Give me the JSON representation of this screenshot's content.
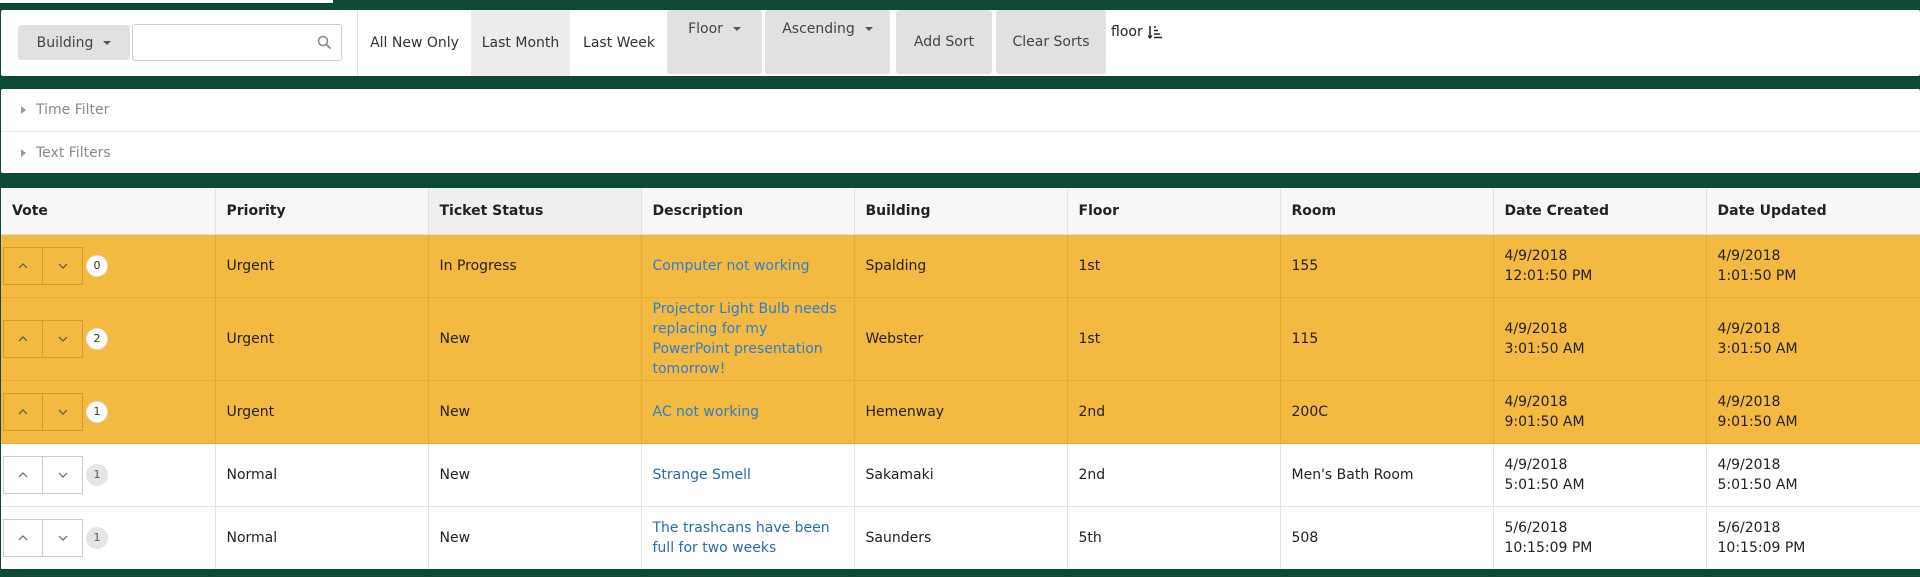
{
  "toolbar": {
    "building_label": "Building",
    "search_value": "",
    "search_placeholder": "",
    "all_new_only": "All New Only",
    "last_month": "Last Month",
    "last_week": "Last Week",
    "floor_label": "Floor",
    "ascending_label": "Ascending",
    "add_sort": "Add Sort",
    "clear_sorts": "Clear Sorts",
    "sort_indicator": "floor"
  },
  "filters": {
    "time_filter": "Time Filter",
    "text_filters": "Text Filters"
  },
  "table": {
    "headers": [
      "Vote",
      "Priority",
      "Ticket Status",
      "Description",
      "Building",
      "Floor",
      "Room",
      "Date Created",
      "Date Updated"
    ],
    "rows": [
      {
        "votes": "0",
        "priority": "Urgent",
        "status": "In Progress",
        "description": "Computer not working",
        "building": "Spalding",
        "floor": "1st",
        "room": "155",
        "created_date": "4/9/2018",
        "created_time": "12:01:50 PM",
        "updated_date": "4/9/2018",
        "updated_time": "1:01:50 PM"
      },
      {
        "votes": "2",
        "priority": "Urgent",
        "status": "New",
        "description": "Projector Light Bulb needs replacing for my PowerPoint presentation tomorrow!",
        "building": "Webster",
        "floor": "1st",
        "room": "115",
        "created_date": "4/9/2018",
        "created_time": "3:01:50 AM",
        "updated_date": "4/9/2018",
        "updated_time": "3:01:50 AM"
      },
      {
        "votes": "1",
        "priority": "Urgent",
        "status": "New",
        "description": "AC not working",
        "building": "Hemenway",
        "floor": "2nd",
        "room": "200C",
        "created_date": "4/9/2018",
        "created_time": "9:01:50 AM",
        "updated_date": "4/9/2018",
        "updated_time": "9:01:50 AM"
      },
      {
        "votes": "1",
        "priority": "Normal",
        "status": "New",
        "description": "Strange Smell",
        "building": "Sakamaki",
        "floor": "2nd",
        "room": "Men's Bath Room",
        "created_date": "4/9/2018",
        "created_time": "5:01:50 AM",
        "updated_date": "4/9/2018",
        "updated_time": "5:01:50 AM"
      },
      {
        "votes": "1",
        "priority": "Normal",
        "status": "New",
        "description": "The trashcans have been full for two weeks",
        "building": "Saunders",
        "floor": "5th",
        "room": "508",
        "created_date": "5/6/2018",
        "created_time": "10:15:09 PM",
        "updated_date": "5/6/2018",
        "updated_time": "10:15:09 PM"
      }
    ]
  },
  "colors": {
    "background": "#0c4a33",
    "urgent_row": "#f4b940",
    "link": "#2f7ec9"
  }
}
